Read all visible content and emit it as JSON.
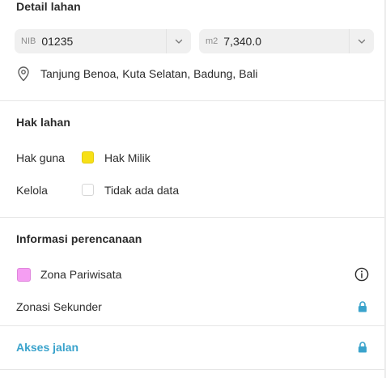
{
  "detail": {
    "title": "Detail lahan",
    "nib": {
      "prefix": "NIB",
      "value": "01235"
    },
    "area": {
      "prefix": "m2",
      "value": "7,340.0"
    },
    "location": "Tanjung Benoa, Kuta Selatan, Badung, Bali"
  },
  "hak": {
    "title": "Hak lahan",
    "rows": [
      {
        "label": "Hak guna",
        "value": "Hak Milik",
        "swatch_color": "#f7e017"
      },
      {
        "label": "Kelola",
        "value": "Tidak ada data",
        "swatch_color": "#ffffff"
      }
    ]
  },
  "perencanaan": {
    "title": "Informasi perencanaan",
    "zona": {
      "label": "Zona Pariwisata",
      "swatch_color": "#f59ef2"
    },
    "sekunder": {
      "label": "Zonasi Sekunder"
    }
  },
  "akses": {
    "label": "Akses jalan"
  },
  "colors": {
    "accent": "#3aa3cc",
    "lock": "#3aa3cc",
    "divider": "#e6e6e6"
  }
}
